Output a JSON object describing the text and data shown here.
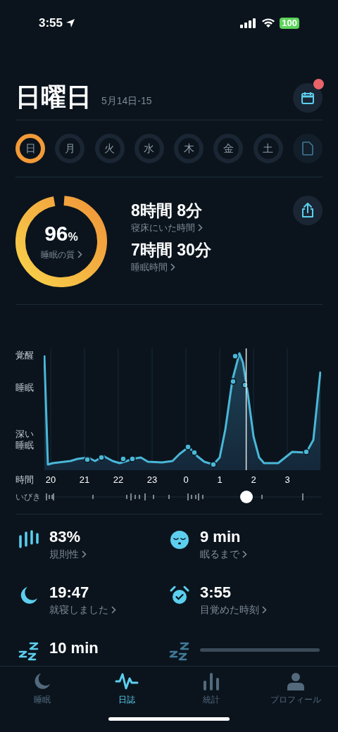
{
  "status_bar": {
    "time": "3:55",
    "battery": "100"
  },
  "header": {
    "title": "日曜日",
    "date": "5月14日-15",
    "calendar_badge": true
  },
  "days": [
    {
      "label": "日",
      "selected": true
    },
    {
      "label": "月",
      "selected": false
    },
    {
      "label": "火",
      "selected": false
    },
    {
      "label": "水",
      "selected": false
    },
    {
      "label": "木",
      "selected": false
    },
    {
      "label": "金",
      "selected": false
    },
    {
      "label": "土",
      "selected": false
    }
  ],
  "quality": {
    "value": "96",
    "unit": "%",
    "label": "睡眠の質"
  },
  "durations": [
    {
      "value": "8時間 8分",
      "label": "寝床にいた時間"
    },
    {
      "value": "7時間 30分",
      "label": "睡眠時間"
    }
  ],
  "graph": {
    "y_labels": [
      "覚醒",
      "睡眠",
      "深い睡眠"
    ],
    "x_title": "時間",
    "hours": [
      "20",
      "21",
      "22",
      "23",
      "0",
      "1",
      "2",
      "3"
    ],
    "snore_label": "いびき"
  },
  "stats": [
    {
      "kind": "bars",
      "value": "83%",
      "label": "規則性"
    },
    {
      "kind": "face",
      "value": "9 min",
      "label": "眠るまで"
    },
    {
      "kind": "moon",
      "value": "19:47",
      "label": "就寝しました"
    },
    {
      "kind": "alarm",
      "value": "3:55",
      "label": "目覚めた時刻"
    },
    {
      "kind": "zzz",
      "value": "10 min"
    },
    {
      "kind": "loading"
    }
  ],
  "tabs": [
    {
      "kind": "moon",
      "label": "睡眠",
      "selected": false
    },
    {
      "kind": "wave",
      "label": "日誌",
      "selected": true
    },
    {
      "kind": "chart",
      "label": "統計",
      "selected": false
    },
    {
      "kind": "person",
      "label": "プロフィール",
      "selected": false
    }
  ]
}
